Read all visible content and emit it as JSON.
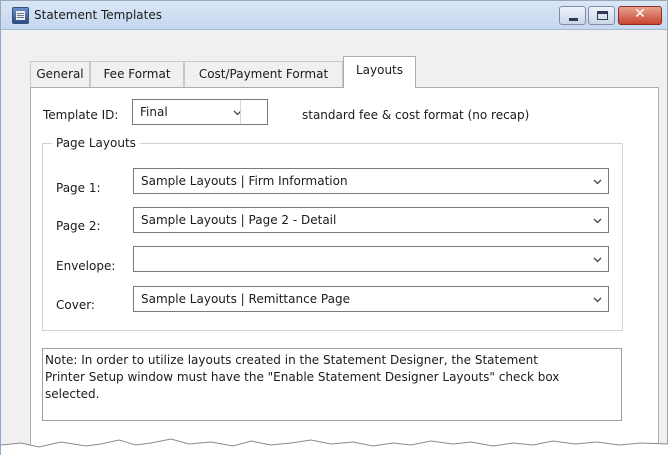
{
  "window": {
    "title": "Statement Templates",
    "controls": {
      "minimize_icon": "minimize-icon",
      "maximize_icon": "maximize-icon",
      "close_icon": "close-icon"
    }
  },
  "tabs": [
    {
      "label": "General",
      "active": false
    },
    {
      "label": "Fee Format",
      "active": false
    },
    {
      "label": "Cost/Payment Format",
      "active": false
    },
    {
      "label": "Layouts",
      "active": true
    }
  ],
  "template": {
    "label": "Template ID:",
    "value": "Final",
    "description": "standard fee & cost format (no recap)"
  },
  "page_layouts": {
    "title": "Page Layouts",
    "rows": [
      {
        "label": "Page 1:",
        "value": "Sample Layouts | Firm Information"
      },
      {
        "label": "Page 2:",
        "value": "Sample Layouts | Page 2 - Detail"
      },
      {
        "label": "Envelope:",
        "value": ""
      },
      {
        "label": "Cover:",
        "value": "Sample Layouts | Remittance Page"
      }
    ]
  },
  "note": {
    "line1": "Note: In order to utilize layouts created in the Statement Designer, the Statement",
    "line2": "Printer Setup window must have the \"Enable Statement Designer Layouts\" check box",
    "line3": "selected."
  },
  "colors": {
    "titlebar": "#c5d7ef",
    "close_button": "#c8442f",
    "panel": "#ffffff",
    "chrome": "#f0f0f0"
  }
}
